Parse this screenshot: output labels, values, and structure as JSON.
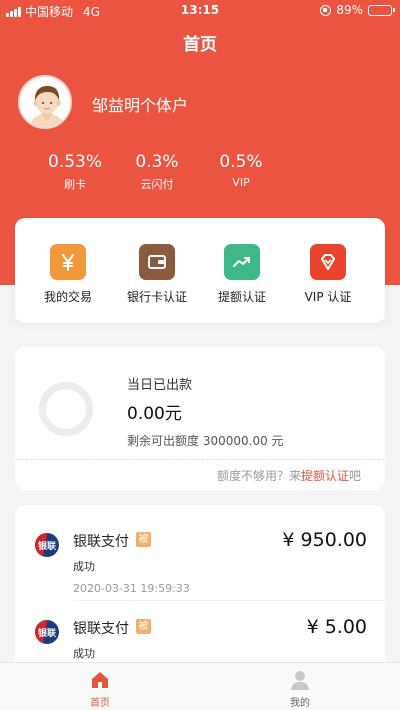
{
  "status_bar": {
    "carrier": "中国移动",
    "network": "4G",
    "time": "13:15",
    "battery": "89%",
    "battery_level": 0.89
  },
  "nav": {
    "title": "首页"
  },
  "profile": {
    "name": "邹益明个体户"
  },
  "rates": [
    {
      "value": "0.53%",
      "label": "刷卡"
    },
    {
      "value": "0.3%",
      "label": "云闪付"
    },
    {
      "value": "0.5%",
      "label": "VIP"
    }
  ],
  "actions": [
    {
      "label": "我的交易",
      "icon": "yen-icon",
      "color": "#f0983a"
    },
    {
      "label": "银行卡认证",
      "icon": "wallet-icon",
      "color": "#8c5a3c"
    },
    {
      "label": "提额认证",
      "icon": "trend-up-icon",
      "color": "#3fb889"
    },
    {
      "label": "VIP 认证",
      "icon": "diamond-icon",
      "color": "#e8452c"
    }
  ],
  "balance": {
    "title": "当日已出款",
    "amount": "0.00元",
    "remaining": "剩余可出额度 300000.00 元",
    "tip_prefix": "额度不够用？来",
    "tip_link": "提额认证",
    "tip_suffix": "吧"
  },
  "transactions": [
    {
      "name": "银联支付",
      "badge": "被",
      "status": "成功",
      "time": "2020-03-31 19:59:33",
      "amount": "¥ 950.00",
      "logo_text": "银联"
    },
    {
      "name": "银联支付",
      "badge": "被",
      "status": "成功",
      "amount": "¥ 5.00",
      "logo_text": "银联"
    }
  ],
  "tabbar": {
    "active_color": "#e25540",
    "inactive_color": "#666666",
    "items": [
      {
        "label": "首页",
        "icon": "home-icon"
      },
      {
        "label": "我的",
        "icon": "user-icon"
      }
    ]
  }
}
